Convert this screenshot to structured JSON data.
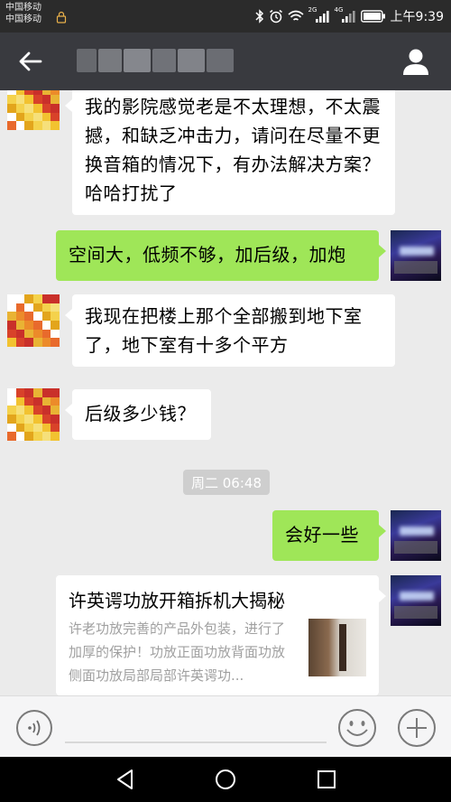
{
  "status_bar": {
    "carrier_top": "中国移动",
    "carrier_bottom": "中国移动",
    "time": "上午9:39",
    "network_1": "2G",
    "network_2": "4G"
  },
  "nav": {
    "back_icon": "back-arrow-icon",
    "title": "",
    "profile_icon": "person-icon"
  },
  "messages": [
    {
      "side": "in",
      "text": "我的影院感觉老是不太理想，不太震撼，和缺乏冲击力，请问在尽量不更换音箱的情况下，有办法解决方案？哈哈打扰了"
    },
    {
      "side": "out",
      "text": "空间大，低频不够，加后级，加炮"
    },
    {
      "side": "in",
      "text": "我现在把楼上那个全部搬到地下室了，地下室有十多个平方"
    },
    {
      "side": "in",
      "text": "后级多少钱？"
    },
    {
      "side": "out",
      "text": "会好一些"
    }
  ],
  "time_divider": "周二 06:48",
  "link_card": {
    "title": "许英谔功放开箱拆机大揭秘",
    "description": "许老功放完善的产品外包装，进行了加厚的保护！功放正面功放背面功放侧面功放局部局部许英谔功..."
  },
  "input_bar": {
    "voice_icon": "voice-icon",
    "emoji_icon": "emoji-icon",
    "more_icon": "plus-icon"
  },
  "system_nav": {
    "back_icon": "triangle-back-icon",
    "home_icon": "circle-home-icon",
    "recents_icon": "square-recents-icon"
  },
  "colors": {
    "status_bar": "#2b2b2b",
    "nav_bar": "#393a3f",
    "chat_bg": "#ebebeb",
    "outgoing_bubble": "#9fe658",
    "incoming_bubble": "#ffffff"
  }
}
